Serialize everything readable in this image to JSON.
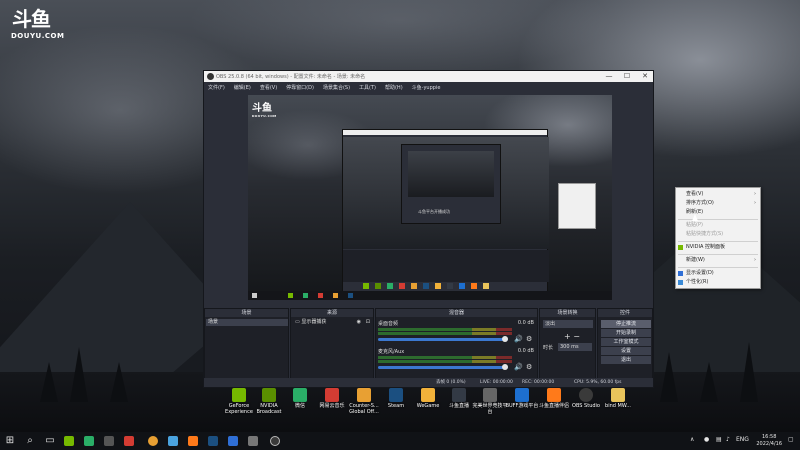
{
  "desktop": {
    "logo_text": "DOUYU.COM",
    "logo_mark": "斗鱼"
  },
  "obs": {
    "title": "OBS 25.0.8 (64 bit, windows) - 配置文件: 未命名 - 场景: 未命名",
    "menu": [
      "文件(F)",
      "编辑(E)",
      "查看(V)",
      "停靠窗口(D)",
      "场景集合(S)",
      "工具(T)",
      "帮助(H)",
      "斗鱼-yuppie"
    ],
    "preview": {
      "nested_caption": "斗鱼平台开播成功"
    },
    "docks": {
      "scenes": {
        "title": "场景",
        "items": [
          "场景"
        ]
      },
      "sources": {
        "title": "来源",
        "items": [
          "显示器捕获"
        ]
      },
      "mixer": {
        "title": "混音器",
        "channels": [
          {
            "name": "桌面音频",
            "db": "0.0 dB"
          },
          {
            "name": "麦克风/Aux",
            "db": "0.0 dB"
          }
        ]
      },
      "transitions": {
        "title": "场景转换",
        "selected": "淡出",
        "duration_label": "时长",
        "duration": "300 ms"
      },
      "controls": {
        "title": "控件",
        "buttons": [
          "停止推流",
          "开始录制",
          "工作室模式",
          "设置",
          "退出"
        ]
      }
    },
    "status": {
      "dropped": "丢帧 0 (0.0%)",
      "live": "LIVE: 00:00:00",
      "rec": "REC: 00:00:00",
      "cpu": "CPU: 5.9%, 60.00 fps"
    }
  },
  "context_menu": {
    "items": [
      {
        "label": "查看(V)",
        "disabled": false,
        "submenu": true
      },
      {
        "label": "排序方式(O)",
        "disabled": false,
        "submenu": true
      },
      {
        "label": "刷新(E)",
        "disabled": false,
        "submenu": false
      },
      {
        "label": "粘贴(P)",
        "disabled": true,
        "submenu": false
      },
      {
        "label": "粘贴快捷方式(S)",
        "disabled": true,
        "submenu": false
      },
      {
        "label": "NVIDIA 控制面板",
        "disabled": false,
        "submenu": false
      },
      {
        "label": "新建(W)",
        "disabled": false,
        "submenu": true
      },
      {
        "label": "显示设置(D)",
        "disabled": false,
        "submenu": false
      },
      {
        "label": "个性化(R)",
        "disabled": false,
        "submenu": false
      }
    ]
  },
  "desktop_icons": [
    {
      "label": "GeForce Experience",
      "icon": "geforce-icon",
      "color": "#76b900"
    },
    {
      "label": "NVIDIA Broadcast",
      "icon": "nvidia-icon",
      "color": "#5a8f00"
    },
    {
      "label": "微信",
      "icon": "wechat-icon",
      "color": "#2aae67"
    },
    {
      "label": "网易云音乐",
      "icon": "netease-music-icon",
      "color": "#d43c33"
    },
    {
      "label": "Counter-S... Global Off...",
      "icon": "csgo-icon",
      "color": "#e8a033"
    },
    {
      "label": "Steam",
      "icon": "steam-icon",
      "color": "#1b4f80"
    },
    {
      "label": "WeGame",
      "icon": "wegame-icon",
      "color": "#f2b23a"
    },
    {
      "label": "斗鱼直播",
      "icon": "douyu-icon",
      "color": "#333a45"
    },
    {
      "label": "完美世界竞技平台",
      "icon": "perfect-world-icon",
      "color": "#666"
    },
    {
      "label": "BUFF游戏平台",
      "icon": "buff-icon",
      "color": "#1d6fd0"
    },
    {
      "label": "斗鱼直播伴侣",
      "icon": "douyu-companion-icon",
      "color": "#ff7a1a"
    },
    {
      "label": "OBS Studio",
      "icon": "obs-icon",
      "color": "#3a3a3a"
    },
    {
      "label": "bind MW...",
      "icon": "folder-icon",
      "color": "#e9c45b"
    }
  ],
  "taskbar": {
    "lang": "ENG",
    "time": "16:58",
    "date": "2022/4/16"
  }
}
